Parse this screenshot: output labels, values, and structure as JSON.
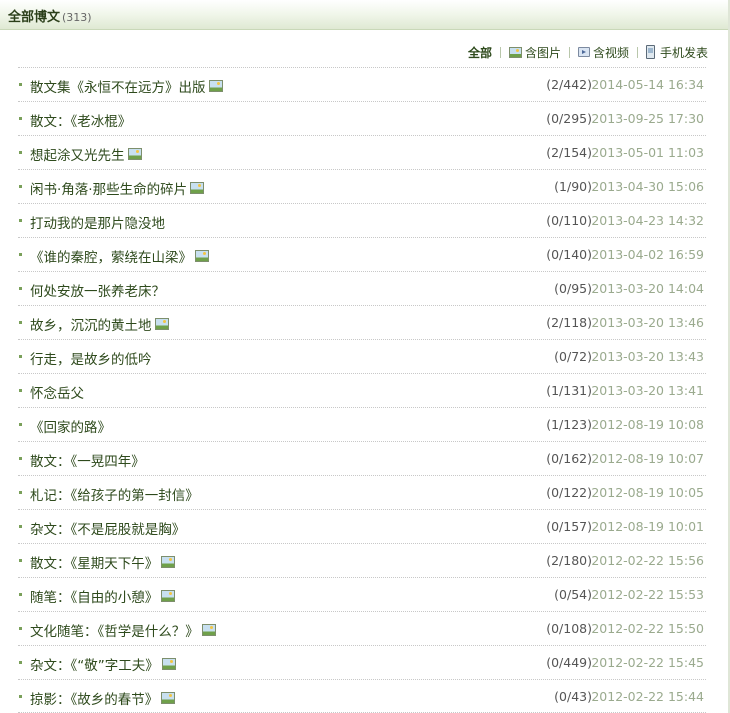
{
  "header": {
    "title": "全部博文",
    "count": "(313)"
  },
  "filters": {
    "all": "全部",
    "with_pictures": "含图片",
    "with_video": "含视频",
    "mobile_post": "手机发表"
  },
  "posts": [
    {
      "title": "散文集《永恒不在远方》出版",
      "has_picture": true,
      "stats": "(2/442)",
      "date": "2014-05-14 16:34"
    },
    {
      "title": "散文：《老冰棍》",
      "has_picture": false,
      "stats": "(0/295)",
      "date": "2013-09-25 17:30"
    },
    {
      "title": "想起涂又光先生",
      "has_picture": true,
      "stats": "(2/154)",
      "date": "2013-05-01 11:03"
    },
    {
      "title": "闲书·角落·那些生命的碎片",
      "has_picture": true,
      "stats": "(1/90)",
      "date": "2013-04-30 15:06"
    },
    {
      "title": "打动我的是那片隐没地",
      "has_picture": false,
      "stats": "(0/110)",
      "date": "2013-04-23 14:32"
    },
    {
      "title": "《谁的秦腔，萦绕在山梁》",
      "has_picture": true,
      "stats": "(0/140)",
      "date": "2013-04-02 16:59"
    },
    {
      "title": "何处安放一张养老床？",
      "has_picture": false,
      "stats": "(0/95)",
      "date": "2013-03-20 14:04"
    },
    {
      "title": "故乡，沉沉的黄土地",
      "has_picture": true,
      "stats": "(2/118)",
      "date": "2013-03-20 13:46"
    },
    {
      "title": "行走，是故乡的低吟",
      "has_picture": false,
      "stats": "(0/72)",
      "date": "2013-03-20 13:43"
    },
    {
      "title": "怀念岳父",
      "has_picture": false,
      "stats": "(1/131)",
      "date": "2013-03-20 13:41"
    },
    {
      "title": "《回家的路》",
      "has_picture": false,
      "stats": "(1/123)",
      "date": "2012-08-19 10:08"
    },
    {
      "title": "散文：《一晃四年》",
      "has_picture": false,
      "stats": "(0/162)",
      "date": "2012-08-19 10:07"
    },
    {
      "title": "札记：《给孩子的第一封信》",
      "has_picture": false,
      "stats": "(0/122)",
      "date": "2012-08-19 10:05"
    },
    {
      "title": "杂文：《不是屁股就是胸》",
      "has_picture": false,
      "stats": "(0/157)",
      "date": "2012-08-19 10:01"
    },
    {
      "title": "散文：《星期天下午》",
      "has_picture": true,
      "stats": "(2/180)",
      "date": "2012-02-22 15:56"
    },
    {
      "title": "随笔：《自由的小憩》",
      "has_picture": true,
      "stats": "(0/54)",
      "date": "2012-02-22 15:53"
    },
    {
      "title": "文化随笔：《哲学是什么？》",
      "has_picture": true,
      "stats": "(0/108)",
      "date": "2012-02-22 15:50"
    },
    {
      "title": "杂文：《“敬”字工夫》",
      "has_picture": true,
      "stats": "(0/449)",
      "date": "2012-02-22 15:45"
    },
    {
      "title": "掠影：《故乡的春节》",
      "has_picture": true,
      "stats": "(0/43)",
      "date": "2012-02-22 15:44"
    }
  ]
}
